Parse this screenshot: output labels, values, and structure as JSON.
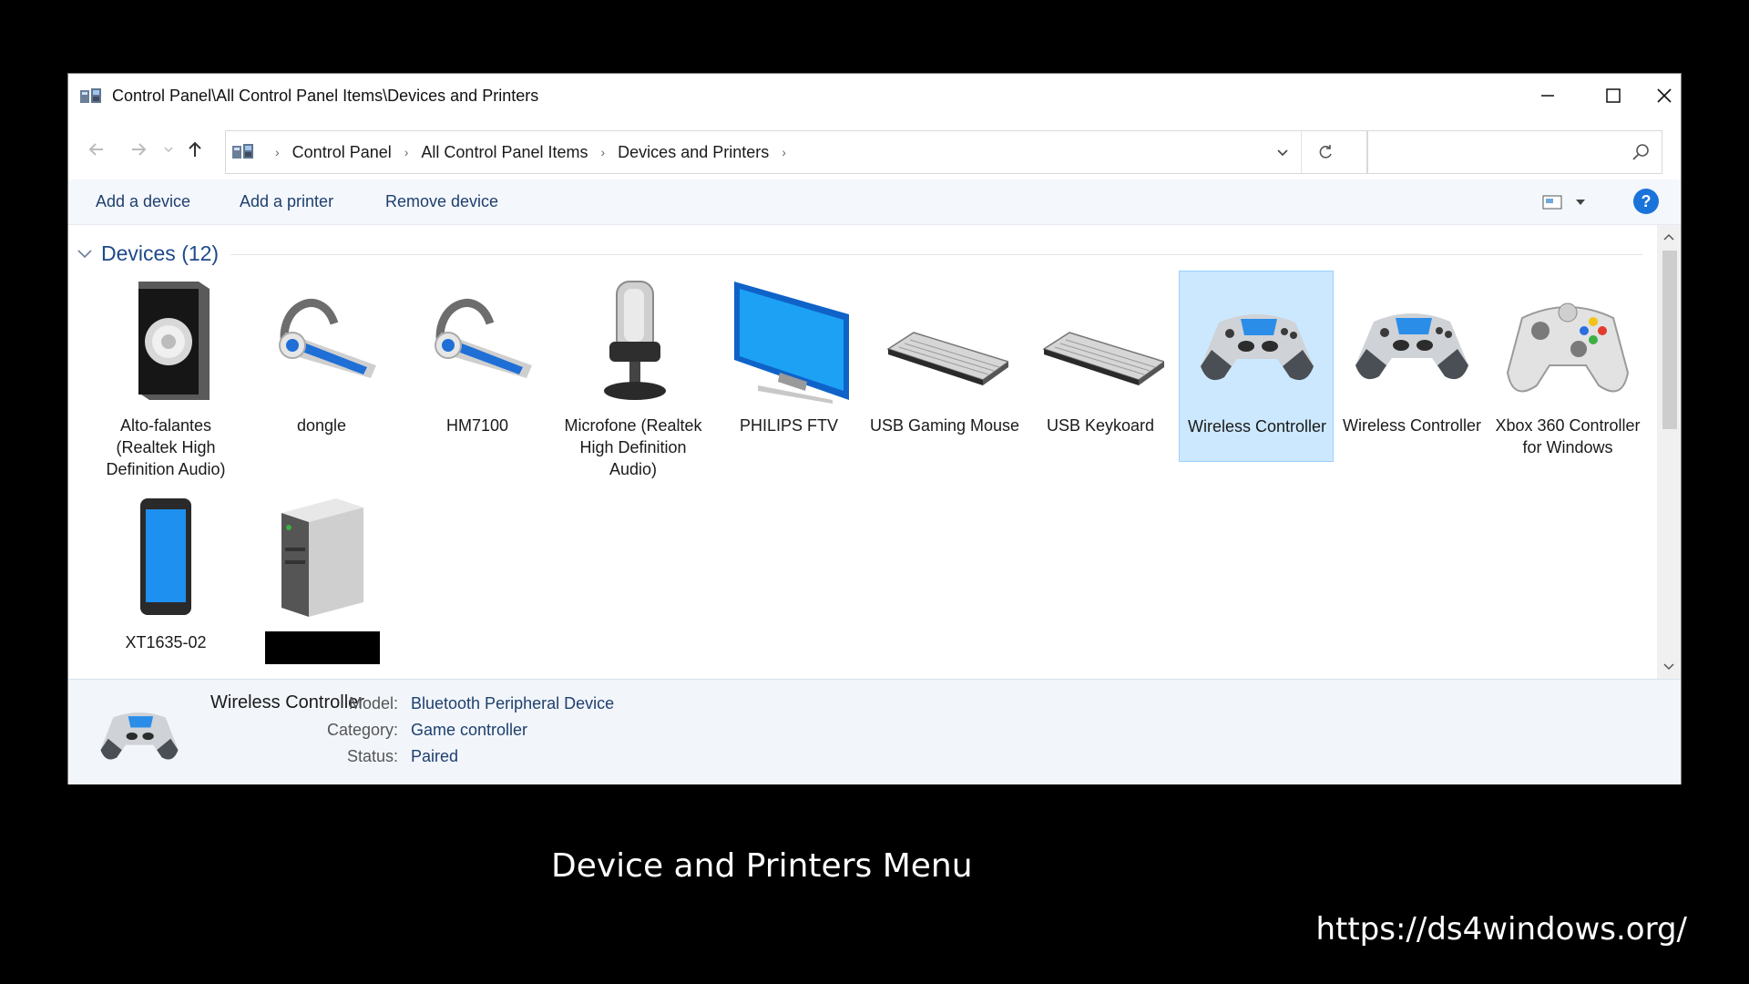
{
  "window": {
    "title": "Control Panel\\All Control Panel Items\\Devices and Printers"
  },
  "address": {
    "crumbs": [
      "Control Panel",
      "All Control Panel Items",
      "Devices and Printers"
    ],
    "search_placeholder": ""
  },
  "commands": {
    "add_device": "Add a device",
    "add_printer": "Add a printer",
    "remove_device": "Remove device"
  },
  "group": {
    "title": "Devices (12)"
  },
  "devices": [
    {
      "label": "Alto-falantes (Realtek High Definition Audio)",
      "icon": "speaker-icon"
    },
    {
      "label": "dongle",
      "icon": "headset-icon"
    },
    {
      "label": "HM7100",
      "icon": "headset-icon"
    },
    {
      "label": "Microfone (Realtek High Definition Audio)",
      "icon": "microphone-icon"
    },
    {
      "label": "PHILIPS FTV",
      "icon": "monitor-icon"
    },
    {
      "label": "USB Gaming Mouse",
      "icon": "keyboard-icon"
    },
    {
      "label": "USB Keykoard",
      "icon": "keyboard-icon"
    },
    {
      "label": "Wireless Controller",
      "icon": "gamepad-icon",
      "selected": true
    },
    {
      "label": "Wireless Controller",
      "icon": "gamepad-icon"
    },
    {
      "label": "Xbox 360 Controller for Windows",
      "icon": "xbox-controller-icon"
    },
    {
      "label": "XT1635-02",
      "icon": "phone-icon"
    },
    {
      "label": "",
      "icon": "computer-tower-icon",
      "redacted": true
    }
  ],
  "details": {
    "name": "Wireless Controller",
    "model_key": "Model:",
    "model_val": "Bluetooth Peripheral Device",
    "category_key": "Category:",
    "category_val": "Game controller",
    "status_key": "Status:",
    "status_val": "Paired"
  },
  "caption": "Device and Printers Menu",
  "url": "https://ds4windows.org/",
  "colors": {
    "selection_bg": "#cce8ff",
    "link_blue": "#1e4a8a",
    "help_blue": "#1a73d9"
  }
}
